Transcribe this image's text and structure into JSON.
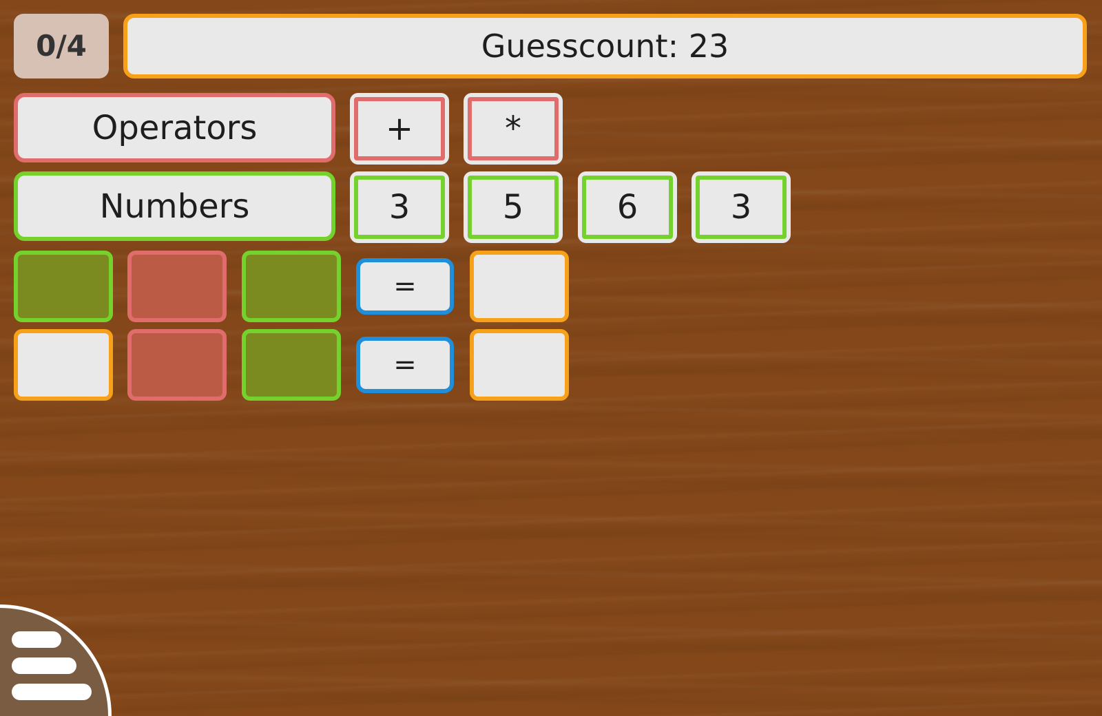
{
  "header": {
    "score": "0/4",
    "guesscount": "Guesscount: 23"
  },
  "palette": {
    "operators_label": "Operators",
    "numbers_label": "Numbers",
    "operators": [
      "+",
      "*"
    ],
    "numbers": [
      "3",
      "5",
      "6",
      "3"
    ]
  },
  "equations": [
    {
      "slots": [
        "green",
        "red",
        "green"
      ],
      "equals": "=",
      "result": ""
    },
    {
      "slots": [
        "empty",
        "red",
        "green"
      ],
      "equals": "=",
      "result": ""
    }
  ],
  "colors": {
    "background": "#834719",
    "panel": "#e9e9e9",
    "operator_accent": "#e06d6b",
    "number_accent": "#75d22c",
    "slot_accent": "#f7a11a",
    "equals_accent": "#1f8fdb",
    "number_slot_fill": "#7c8b1f",
    "operator_slot_fill": "#bb5a45",
    "menu": "#7a5c42"
  },
  "icons": {
    "menu": "hamburger-menu-icon"
  }
}
